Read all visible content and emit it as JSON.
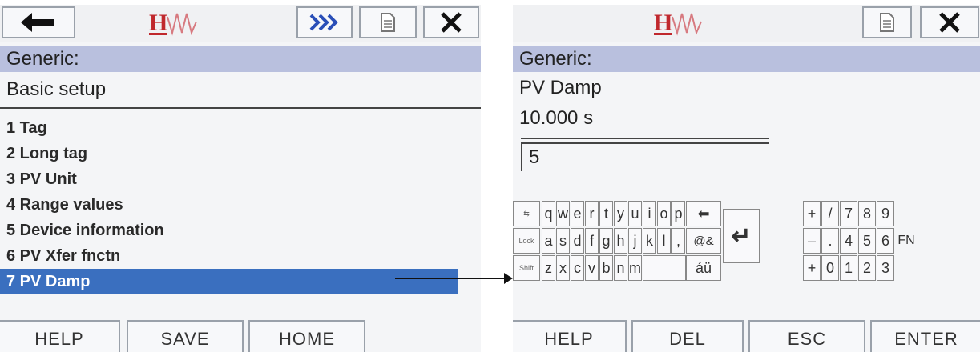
{
  "left": {
    "toolbar": {
      "logo": "H",
      "back_icon": "arrow-left-icon",
      "forward_icon": "double-chevron-right-icon",
      "doc_icon": "document-icon",
      "close_icon": "close-icon"
    },
    "header": "Generic:",
    "subtitle": "Basic setup",
    "menu": [
      {
        "label": "1 Tag"
      },
      {
        "label": "2 Long tag"
      },
      {
        "label": "3 PV Unit"
      },
      {
        "label": "4 Range values"
      },
      {
        "label": "5 Device information"
      },
      {
        "label": "6 PV Xfer fnctn"
      },
      {
        "label": "7 PV Damp",
        "selected": true
      }
    ],
    "buttons": {
      "help": "HELP",
      "save": "SAVE",
      "home": "HOME"
    }
  },
  "right": {
    "toolbar": {
      "logo": "H",
      "doc_icon": "document-icon",
      "close_icon": "close-icon"
    },
    "header": "Generic:",
    "param_name": "PV Damp",
    "param_value": "10.000 s",
    "input_value": "5",
    "keyboard": {
      "row1": [
        "q",
        "w",
        "e",
        "r",
        "t",
        "y",
        "u",
        "i",
        "o",
        "p"
      ],
      "row2": [
        "a",
        "s",
        "d",
        "f",
        "g",
        "h",
        "j",
        "k",
        "l",
        ","
      ],
      "row3": [
        "z",
        "x",
        "c",
        "v",
        "b",
        "n",
        "m"
      ],
      "special": {
        "tab": "⇆",
        "lock": "Lock",
        "shift": "Shift",
        "symbols": "@&",
        "accents": "áü",
        "backspace": "⬅",
        "enter": "↵",
        "fn": "FN"
      },
      "numpad": {
        "row1": [
          "+",
          "/",
          "7",
          "8",
          "9"
        ],
        "row2": [
          "–",
          ".",
          "4",
          "5",
          "6"
        ],
        "row3": [
          "+",
          "0",
          "1",
          "2",
          "3"
        ]
      }
    },
    "buttons": {
      "help": "HELP",
      "del": "DEL",
      "esc": "ESC",
      "enter": "ENTER"
    }
  },
  "colors": {
    "band": "#b9c0de",
    "selected": "#3a6fbf",
    "logo": "#c0282d",
    "forward_icon": "#2a4fb8"
  }
}
